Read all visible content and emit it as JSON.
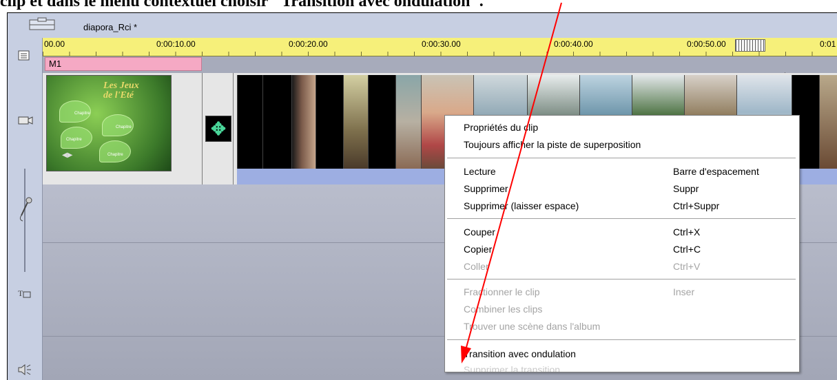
{
  "document": {
    "caption": "clip et dans le menu contextuel choisir \"Transition avec ondulation\"."
  },
  "window": {
    "title": "diapora_Rci *"
  },
  "ruler": {
    "labels": [
      "00.00",
      "0:00:10.00",
      "0:00:20.00",
      "0:00:30.00",
      "0:00:40.00",
      "0:00:50.00",
      "0:01"
    ]
  },
  "tracks": {
    "marker_label": "M1"
  },
  "menu_clip": {
    "title_line1": "Les Jeux",
    "title_line2": "de l'Eté",
    "chapter_label": "Chapitre"
  },
  "context_menu": {
    "items": [
      {
        "label": "Propriétés du clip",
        "shortcut": "",
        "enabled": true
      },
      {
        "label": "Toujours afficher la piste de superposition",
        "shortcut": "",
        "enabled": true
      },
      {
        "label": "Lecture",
        "shortcut": "Barre d'espacement",
        "enabled": true
      },
      {
        "label": "Supprimer",
        "shortcut": "Suppr",
        "enabled": true
      },
      {
        "label": "Supprimer (laisser espace)",
        "shortcut": "Ctrl+Suppr",
        "enabled": true
      },
      {
        "label": "Couper",
        "shortcut": "Ctrl+X",
        "enabled": true
      },
      {
        "label": "Copier",
        "shortcut": "Ctrl+C",
        "enabled": true
      },
      {
        "label": "Coller",
        "shortcut": "Ctrl+V",
        "enabled": false
      },
      {
        "label": "Fractionner le clip",
        "shortcut": "Inser",
        "enabled": false
      },
      {
        "label": "Combiner les clips",
        "shortcut": "",
        "enabled": false
      },
      {
        "label": "Trouver une scène dans l'album",
        "shortcut": "",
        "enabled": false
      },
      {
        "label": "Transition avec ondulation",
        "shortcut": "",
        "enabled": true
      },
      {
        "label": "Supprimer la transition",
        "shortcut": "",
        "enabled": false
      }
    ]
  },
  "colors": {
    "ruler": "#f6f07a",
    "marker": "#f5a9c4",
    "clip_strip": "#9daee2",
    "annotation_arrow": "#ff0000",
    "panel": "#c7cfe2"
  },
  "icons": {
    "toolbar": "storyboard-icon",
    "list": "list-icon",
    "video": "camera-icon",
    "audio": "microphone-icon",
    "title": "title-icon",
    "sound": "speaker-icon",
    "transition": "transition-arrows-icon"
  }
}
